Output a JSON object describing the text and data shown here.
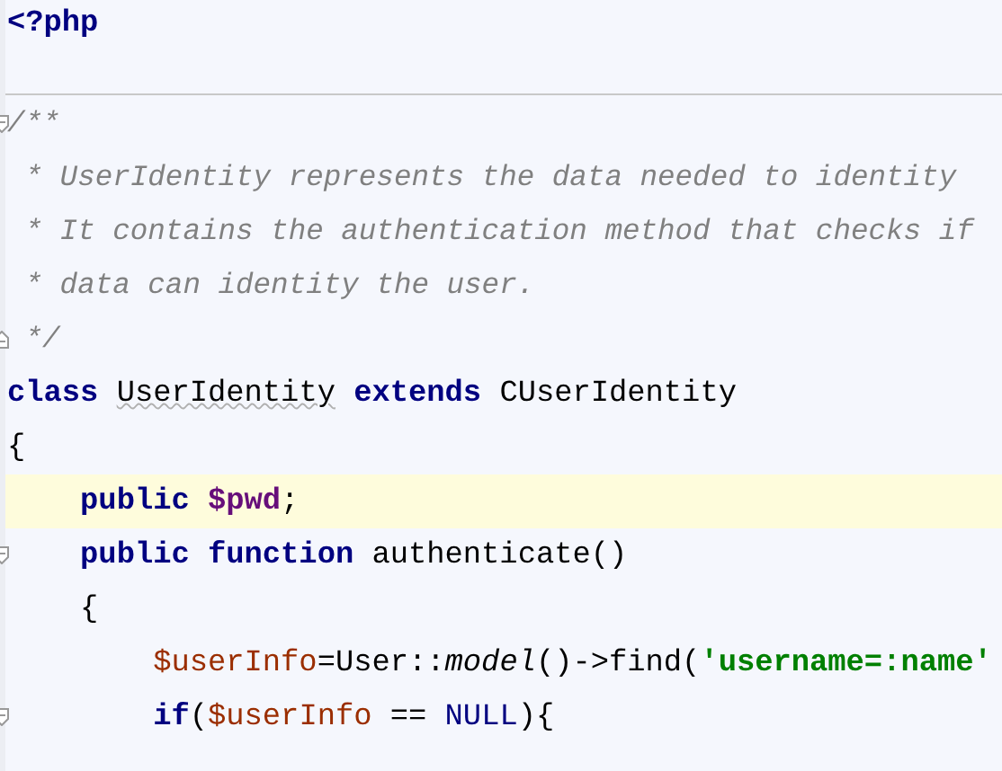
{
  "header_line": {
    "tokens": [
      {
        "text": "<?php",
        "kind": "keyword"
      }
    ]
  },
  "lines": [
    {
      "kind": "fold_start",
      "highlighted": false,
      "tokens": [
        {
          "text": "/**",
          "kind": "comment"
        }
      ]
    },
    {
      "kind": "plain",
      "highlighted": false,
      "tokens": [
        {
          "text": " * UserIdentity represents the data needed to identity",
          "kind": "comment"
        }
      ]
    },
    {
      "kind": "plain",
      "highlighted": false,
      "tokens": [
        {
          "text": " * It contains the authentication method that checks if",
          "kind": "comment"
        }
      ]
    },
    {
      "kind": "plain",
      "highlighted": false,
      "tokens": [
        {
          "text": " * data can identity the user.",
          "kind": "comment"
        }
      ]
    },
    {
      "kind": "fold_end",
      "highlighted": false,
      "tokens": [
        {
          "text": " */",
          "kind": "comment"
        }
      ]
    },
    {
      "kind": "plain",
      "highlighted": false,
      "tokens": [
        {
          "text": "class ",
          "kind": "keyword"
        },
        {
          "text": "UserIdentity",
          "kind": "typo"
        },
        {
          "text": " extends",
          "kind": "keyword"
        },
        {
          "text": " CUserIdentity",
          "kind": "plain"
        }
      ]
    },
    {
      "kind": "plain",
      "highlighted": false,
      "tokens": [
        {
          "text": "{",
          "kind": "plain"
        }
      ]
    },
    {
      "kind": "plain",
      "highlighted": true,
      "tokens": [
        {
          "text": "    public ",
          "kind": "keyword"
        },
        {
          "text": "$pwd",
          "kind": "field"
        },
        {
          "text": ";",
          "kind": "plain"
        }
      ]
    },
    {
      "kind": "fold_start",
      "highlighted": false,
      "tokens": [
        {
          "text": "    public function",
          "kind": "keyword"
        },
        {
          "text": " authenticate()",
          "kind": "plain"
        }
      ]
    },
    {
      "kind": "plain",
      "highlighted": false,
      "tokens": [
        {
          "text": "    {",
          "kind": "plain"
        }
      ]
    },
    {
      "kind": "plain",
      "highlighted": false,
      "tokens": [
        {
          "text": "        $userInfo",
          "kind": "variable"
        },
        {
          "text": "=User::",
          "kind": "plain"
        },
        {
          "text": "model",
          "kind": "static"
        },
        {
          "text": "()->find(",
          "kind": "plain"
        },
        {
          "text": "'username=:name'",
          "kind": "string"
        }
      ]
    },
    {
      "kind": "fold_start",
      "highlighted": false,
      "tokens": [
        {
          "text": "        if",
          "kind": "keyword"
        },
        {
          "text": "(",
          "kind": "plain"
        },
        {
          "text": "$userInfo",
          "kind": "variable"
        },
        {
          "text": " == ",
          "kind": "plain"
        },
        {
          "text": "NULL",
          "kind": "constant"
        },
        {
          "text": "){",
          "kind": "plain"
        }
      ]
    }
  ]
}
